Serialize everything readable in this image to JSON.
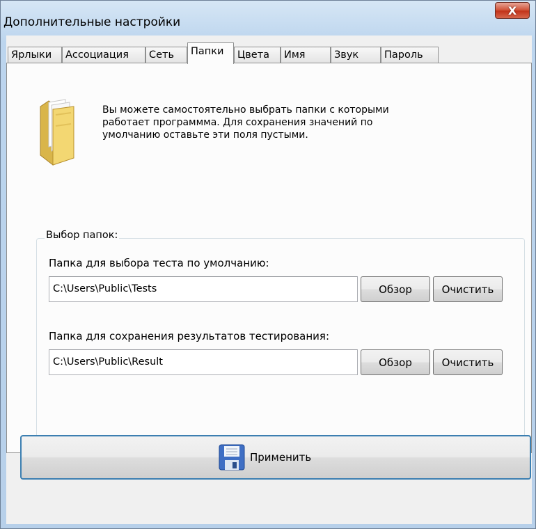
{
  "window": {
    "title": "Дополнительные настройки",
    "close_label": "X"
  },
  "tabs": [
    {
      "label": "Ярлыки"
    },
    {
      "label": "Ассоциация"
    },
    {
      "label": "Сеть"
    },
    {
      "label": "Папки",
      "active": true
    },
    {
      "label": "Цвета"
    },
    {
      "label": "Имя"
    },
    {
      "label": "Звук"
    },
    {
      "label": "Пароль"
    }
  ],
  "info": {
    "icon": "folder-icon",
    "lines": [
      "Вы можете самостоятельно выбрать папки с которыми",
      "работает программма. Для сохранения значений по",
      "умолчанию оставьте эти поля пустыми."
    ]
  },
  "folders": {
    "group_title": "Выбор папок:",
    "tests": {
      "label": "Папка для выбора теста по умолчанию:",
      "value": "C:\\Users\\Public\\Tests",
      "browse": "Обзор",
      "clear": "Очистить"
    },
    "results": {
      "label": "Папка для сохранения результатов тестирования:",
      "value": "C:\\Users\\Public\\Result",
      "browse": "Обзор",
      "clear": "Очистить"
    }
  },
  "apply": {
    "icon": "floppy-disk-icon",
    "label": "Применить"
  },
  "colors": {
    "accent": "#3c7fb1",
    "close": "#c2341b"
  }
}
